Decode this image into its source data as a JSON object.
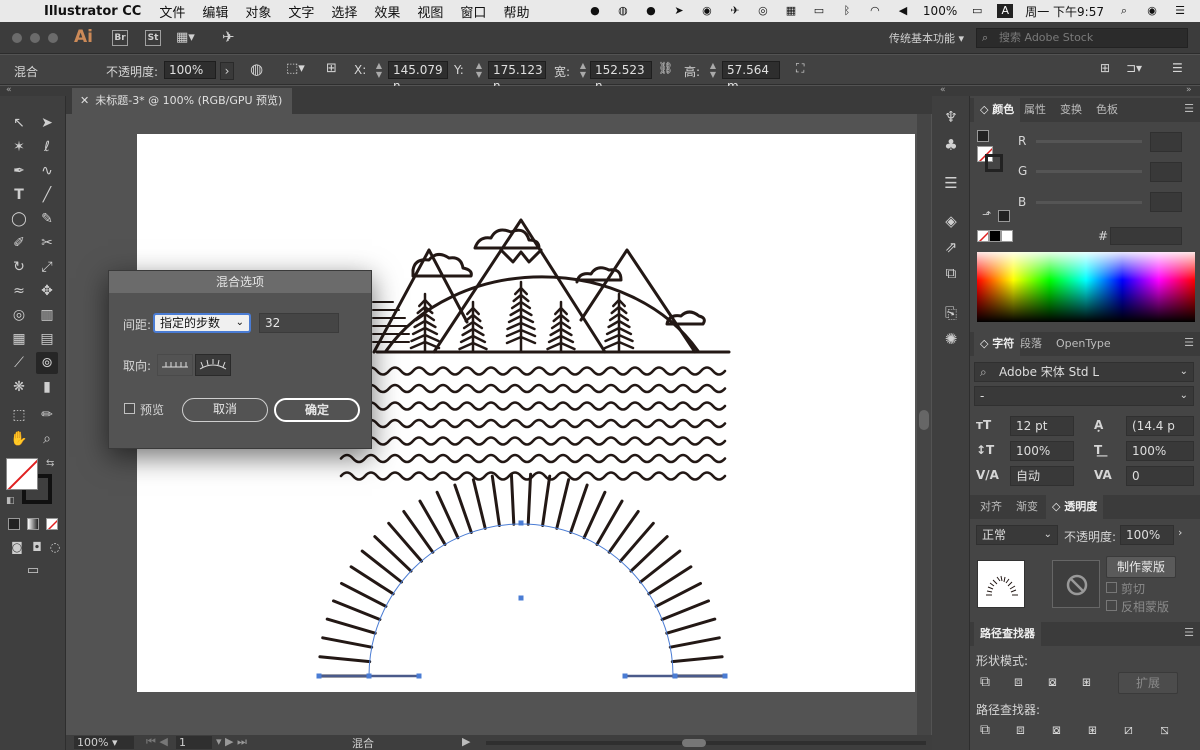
{
  "menubar": {
    "app": "Illustrator CC",
    "items": [
      "文件",
      "编辑",
      "对象",
      "文字",
      "选择",
      "效果",
      "视图",
      "窗口",
      "帮助"
    ],
    "battery": "100%",
    "clock": "周一 下午9:57"
  },
  "appbar": {
    "logo": "Ai",
    "bridge": "Br",
    "stock_btn": "St",
    "workspace": "传统基本功能",
    "stock_search_placeholder": "搜索 Adobe Stock"
  },
  "controlbar": {
    "object_type": "混合",
    "opacity_label": "不透明度:",
    "opacity_value": "100%",
    "x_label": "X:",
    "x_value": "145.079 n",
    "y_label": "Y:",
    "y_value": "175.123 n",
    "w_label": "宽:",
    "w_value": "152.523 n",
    "h_label": "高:",
    "h_value": "57.564 m"
  },
  "document": {
    "tab_title": "未标题-3* @ 100% (RGB/GPU 预览)"
  },
  "statusbar": {
    "zoom": "100%",
    "artboard": "1",
    "tool_status": "混合"
  },
  "blend_dialog": {
    "title": "混合选项",
    "spacing_label": "间距:",
    "spacing_value": "指定的步数",
    "steps_value": "32",
    "orientation_label": "取向:",
    "preview_label": "预览",
    "cancel": "取消",
    "ok": "确定"
  },
  "color_panel": {
    "tabs": [
      "颜色",
      "属性",
      "变换",
      "色板"
    ],
    "r_label": "R",
    "g_label": "G",
    "b_label": "B",
    "hex_label": "#"
  },
  "character_panel": {
    "tabs": [
      "字符",
      "段落",
      "OpenType"
    ],
    "font_family": "Adobe 宋体 Std L",
    "font_style": "-",
    "font_size": "12 pt",
    "leading": "(14.4 p",
    "vscale": "100%",
    "hscale": "100%",
    "kerning": "自动",
    "tracking": "0"
  },
  "transparency_panel": {
    "tabs": [
      "对齐",
      "渐变",
      "透明度"
    ],
    "blend_mode": "正常",
    "opacity_label": "不透明度:",
    "opacity_value": "100%",
    "make_mask": "制作蒙版",
    "clip": "剪切",
    "invert_mask": "反相蒙版"
  },
  "pathfinder_panel": {
    "title": "路径查找器",
    "shape_modes": "形状模式:",
    "expand": "扩展",
    "pathfinders": "路径查找器:"
  },
  "colors": {
    "artboard": "#ffffff",
    "ink": "#231815",
    "selection": "#4a7cd4",
    "workspace": "#535353"
  }
}
